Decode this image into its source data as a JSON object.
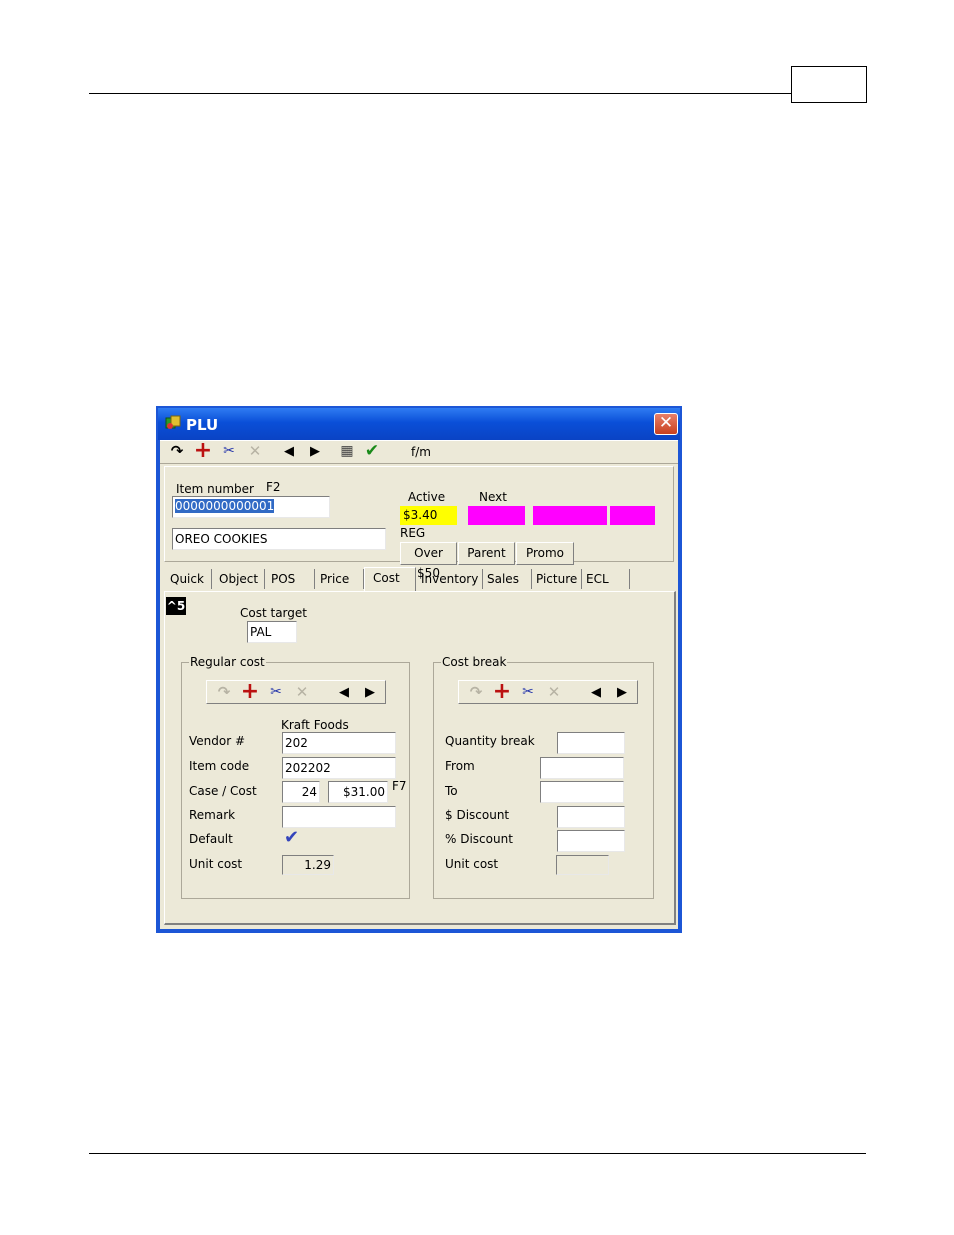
{
  "window": {
    "title": "PLU"
  },
  "toolbar": {
    "fm_label": "f/m"
  },
  "header": {
    "item_number_label": "Item number",
    "item_number_key": "F2",
    "item_number_value": "0000000000001",
    "description_value": "OREO COOKIES",
    "active_label": "Active",
    "next_label": "Next",
    "active_price": "$3.40",
    "price_type": "REG",
    "buttons": [
      "Over $50",
      "Parent",
      "Promo"
    ]
  },
  "tabs": [
    "Quick",
    "Object",
    "POS",
    "Price",
    "Cost",
    "Inventory",
    "Sales",
    "Picture",
    "ECL"
  ],
  "active_tab": "Cost",
  "badge": "^5",
  "cost_target": {
    "label": "Cost target",
    "value": "PAL"
  },
  "regular_cost": {
    "title": "Regular cost",
    "vendor_name": "Kraft Foods",
    "vendor_label": "Vendor #",
    "vendor_value": "202",
    "item_code_label": "Item code",
    "item_code_value": "202202",
    "case_cost_label": "Case / Cost",
    "case_value": "24",
    "cost_value": "$31.00",
    "cost_key": "F7",
    "remark_label": "Remark",
    "remark_value": "",
    "default_label": "Default",
    "unit_cost_label": "Unit cost",
    "unit_cost_value": "1.29"
  },
  "cost_break": {
    "title": "Cost break",
    "quantity_break_label": "Quantity break",
    "from_label": "From",
    "to_label": "To",
    "dollar_discount_label": "$ Discount",
    "percent_discount_label": "% Discount",
    "unit_cost_label": "Unit cost"
  },
  "colors": {
    "active_price_bg": "#ffff00",
    "next_price_bg": "#ff00ff"
  }
}
